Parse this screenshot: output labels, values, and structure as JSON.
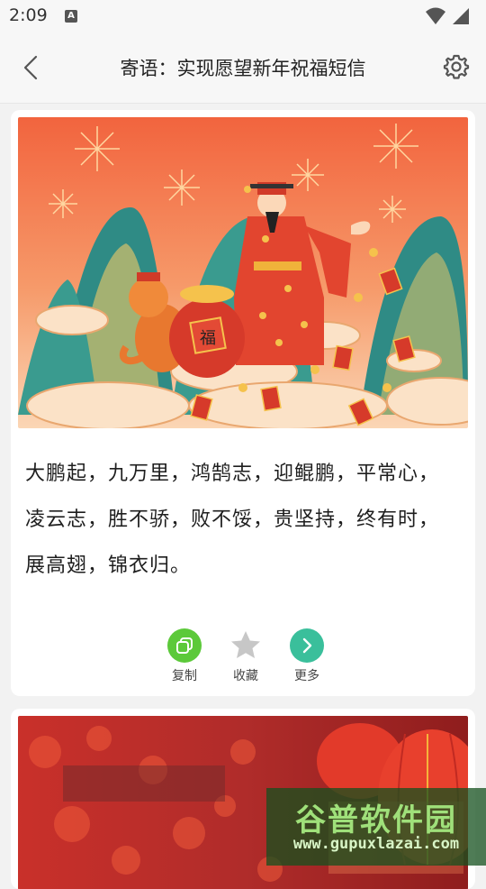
{
  "status": {
    "time": "2:09",
    "notification_badge": "A"
  },
  "header": {
    "title": "寄语：实现愿望新年祝福短信"
  },
  "cards": [
    {
      "text": "大鹏起，九万里，鸿鹄志，迎鲲鹏，平常心，凌云志，胜不骄，败不馁，贵坚持，终有时，展高翅，锦衣归。",
      "seal_text": "福",
      "actions": {
        "copy_label": "复制",
        "favorite_label": "收藏",
        "more_label": "更多"
      }
    }
  ],
  "watermark": {
    "title": "谷普软件园",
    "url": "www.gupuxlazai.com"
  },
  "colors": {
    "copy_green": "#5cc93a",
    "more_teal": "#3abf9b",
    "star_gray": "#c7c7c7"
  }
}
